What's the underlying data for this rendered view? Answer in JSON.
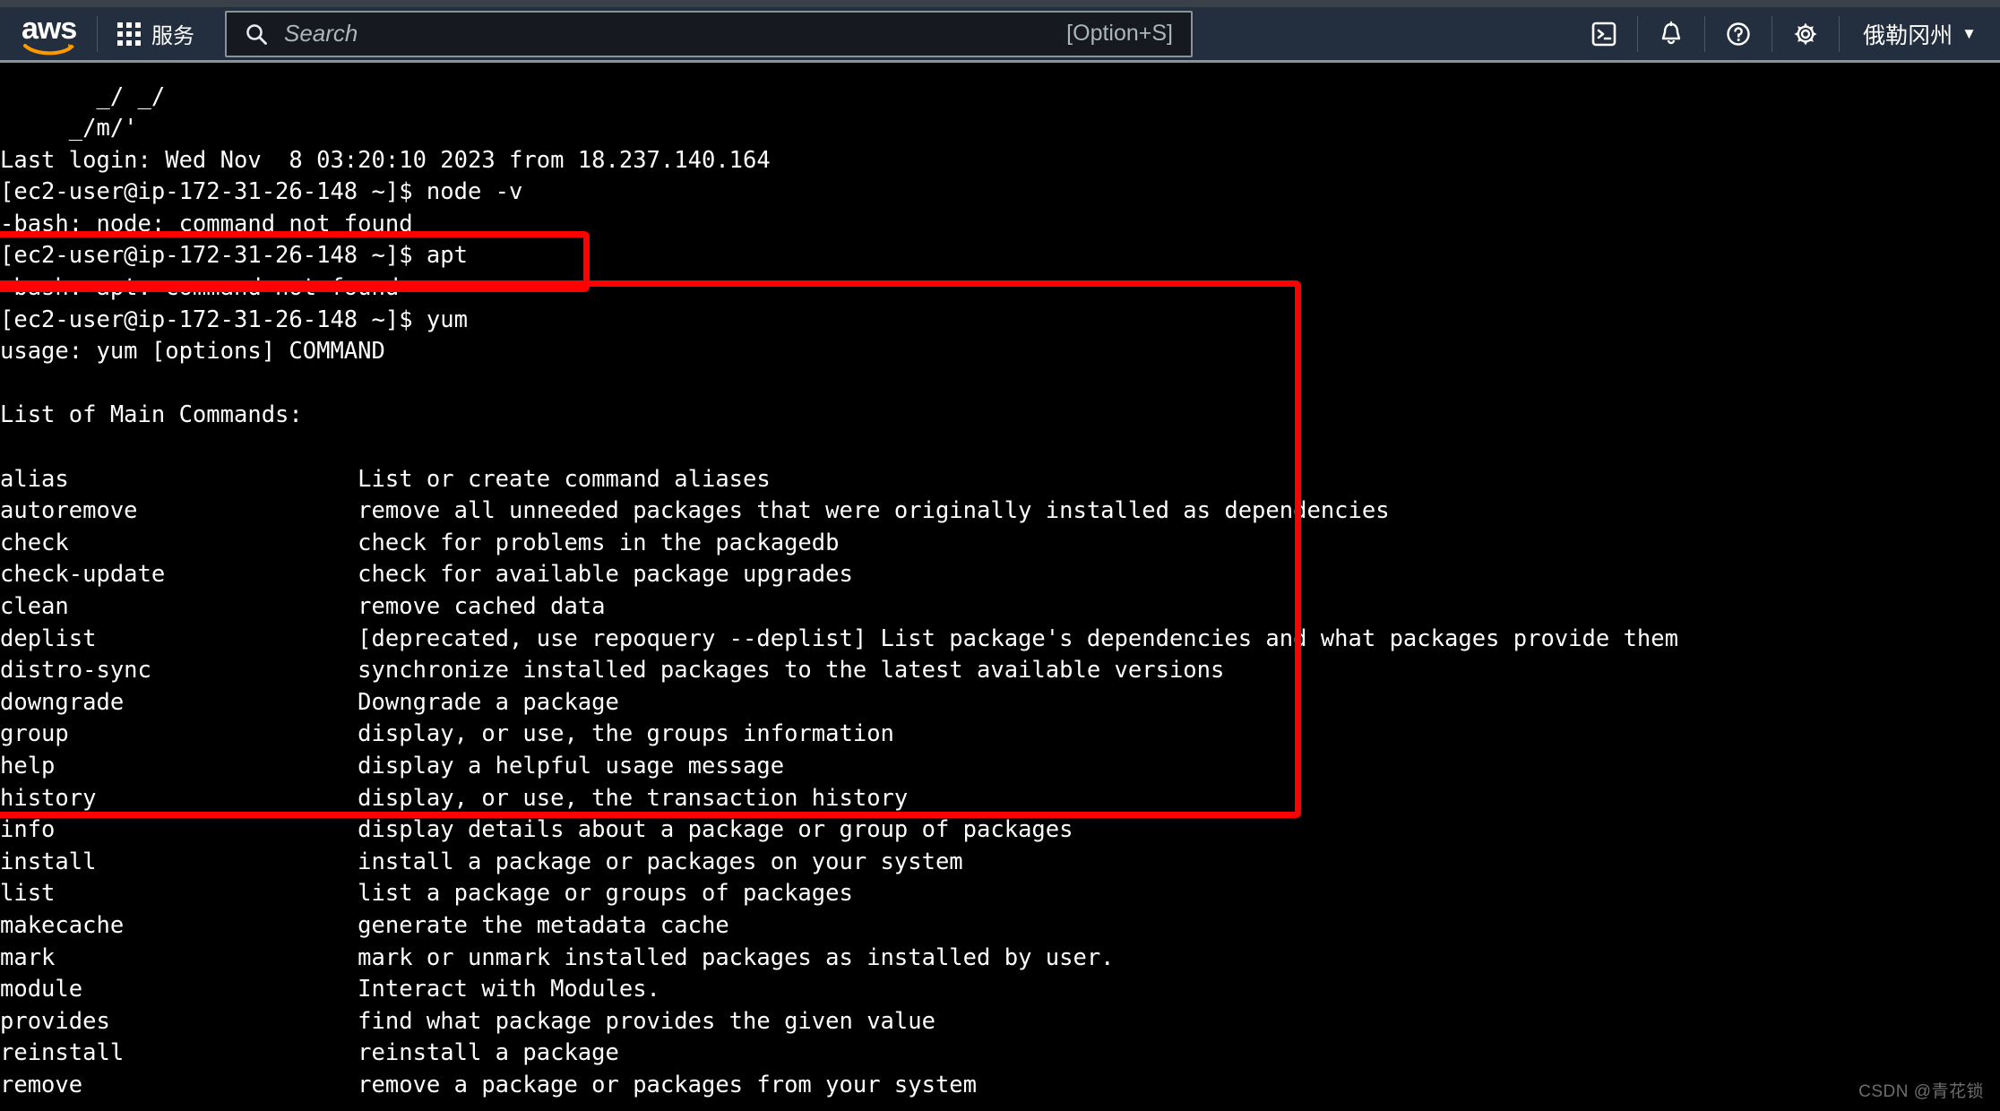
{
  "header": {
    "logo_text": "aws",
    "logo_icon": "aws-smile-logo",
    "services_label": "服务",
    "services_icon": "grid-apps-icon",
    "search": {
      "placeholder": "Search",
      "value": "",
      "shortcut_hint": "[Option+S]",
      "icon": "search-icon"
    },
    "icons": [
      {
        "name": "cloudshell-icon",
        "title": "CloudShell"
      },
      {
        "name": "bell-notifications-icon",
        "title": "Notifications"
      },
      {
        "name": "question-help-icon",
        "title": "Help"
      },
      {
        "name": "gear-settings-icon",
        "title": "Settings"
      }
    ],
    "region_label": "俄勒冈州",
    "region_caret": "▼",
    "colors": {
      "header_bg": "#232f3e",
      "top_strip": "#3b4149",
      "header_border": "#879596",
      "logo_orange": "#ff9900",
      "search_bg": "#16191f",
      "search_border": "#879596",
      "text": "#ffffff",
      "muted_text": "#aab7b8"
    }
  },
  "terminal": {
    "colors": {
      "bg": "#000000",
      "fg": "#ffffff"
    },
    "content": "       _/ _/\n     _/m/'\nLast login: Wed Nov  8 03:20:10 2023 from 18.237.140.164\n[ec2-user@ip-172-31-26-148 ~]$ node -v\n-bash: node: command not found\n[ec2-user@ip-172-31-26-148 ~]$ apt\n-bash: apt: command not found\n[ec2-user@ip-172-31-26-148 ~]$ yum\nusage: yum [options] COMMAND\n\nList of Main Commands:\n\nalias                     List or create command aliases\nautoremove                remove all unneeded packages that were originally installed as dependencies\ncheck                     check for problems in the packagedb\ncheck-update              check for available package upgrades\nclean                     remove cached data\ndeplist                   [deprecated, use repoquery --deplist] List package's dependencies and what packages provide them\ndistro-sync               synchronize installed packages to the latest available versions\ndowngrade                 Downgrade a package\ngroup                     display, or use, the groups information\nhelp                      display a helpful usage message\nhistory                   display, or use, the transaction history\ninfo                      display details about a package or group of packages\ninstall                   install a package or packages on your system\nlist                      list a package or groups of packages\nmakecache                 generate the metadata cache\nmark                      mark or unmark installed packages as installed by user.\nmodule                    Interact with Modules.\nprovides                  find what package provides the given value\nreinstall                 reinstall a package\nremove                    remove a package or packages from your system"
  },
  "annotations": {
    "color": "#fe0000",
    "boxes": [
      {
        "name": "apt-command-highlight",
        "target": "apt command and not-found output"
      },
      {
        "name": "yum-command-highlight",
        "target": "yum usage and main commands list"
      }
    ]
  },
  "watermark": {
    "text": "CSDN @青花锁"
  }
}
